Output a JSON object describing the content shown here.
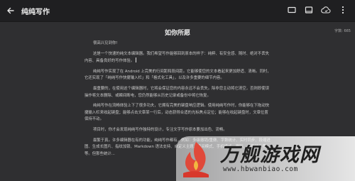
{
  "app": {
    "title": "纯纯写作",
    "back_icon": "arrow-left-icon"
  },
  "toolbar": {
    "icons": [
      "screen-icon",
      "tablet-icon",
      "cloud-sync-icon",
      "more-vertical-icon"
    ]
  },
  "document": {
    "title": "如你所愿",
    "word_count": "字数: 665",
    "paragraphs": [
      "很高兴见到你!",
      "这是一个快速的纯文本编辑器。我们希望写作能够回到原本的样子：纯粹、有安全感、随时、绝对不丢失内容、具备良好的写作体验。",
      "纯纯写作实现了在 Android 上完美的行间距和段间距。它能够使您的文本看起来更加舒适、清晰。同时，它还实现了「纯纯写作快捷输入栏」和「格式化工具」，以及许多重要的细节内容。",
      "最重要的，在使用这个编辑器时，它将会保证您的内容永远不会丢失。除非您主动将它清空，否则即使误操作将文本删除、或瞬间断电，您仍然能够从历史记录或备份中将它恢复。",
      "纯纯写作在流畅体验上下了很多功夫，它拥有完美的键盘响应逻辑。使用纯纯写作时，你能够在下拖动快捷输入栏来收起键盘；能够点击文章某一行后，动态获得合适的光标焦点定位；能够在收起键盘时，文章位置保持不动。",
      "项目时，你才会发现纯纯写作独特的设计，专注文字写作原本要加出色、流畅。",
      "最繁于真。许多编辑器在有的功能，纯纯写作都有，例如：多级撤销/重做、字数统计、实时同步、段缩进图、生成长图片、指纹加锁、Markdown 语法支持、自定义主题、夜间模式、手机模式、删除、字数统计等等。但那些统计..."
    ]
  },
  "watermark": {
    "name": "万舰游戏网",
    "url": "www.hbwanbiao.com"
  }
}
